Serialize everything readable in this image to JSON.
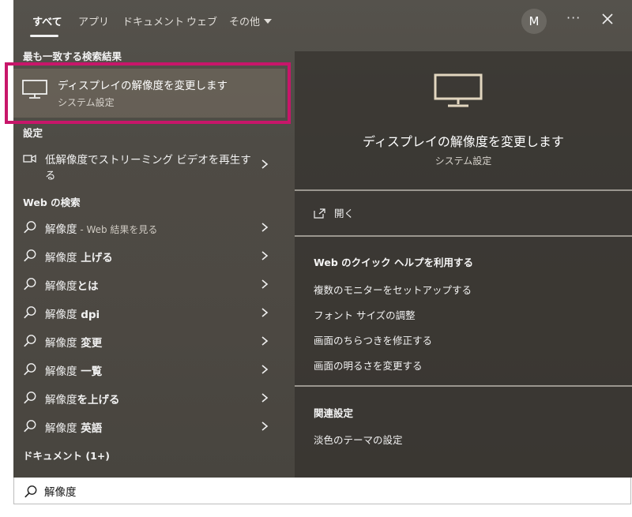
{
  "tabs": [
    {
      "label": "すべて",
      "active": true
    },
    {
      "label": "アプリ"
    },
    {
      "label": "ドキュメント"
    },
    {
      "label": "ウェブ"
    },
    {
      "label": "その他"
    }
  ],
  "account": {
    "initial": "M"
  },
  "more_label": "···",
  "best_match": {
    "heading": "最も一致する検索結果",
    "title": "ディスプレイの解像度を変更します",
    "subtitle": "システム設定",
    "icon": "monitor-icon"
  },
  "settings": {
    "heading": "設定",
    "items": [
      {
        "label_line1": "低解像度でストリーミング ビデオを再生す",
        "label_line2": "る",
        "icon": "video-icon"
      }
    ]
  },
  "web_search": {
    "heading": "Web の検索",
    "items": [
      {
        "query": "解像度",
        "suffix": " - Web 結果を見る"
      },
      {
        "query": "解像度",
        "bold": " 上げる"
      },
      {
        "query": "解像度",
        "bold": "とは"
      },
      {
        "query": "解像度",
        "bold": " dpi"
      },
      {
        "query": "解像度",
        "bold": " 変更"
      },
      {
        "query": "解像度",
        "bold": " 一覧"
      },
      {
        "query": "解像度",
        "bold": "を上げる"
      },
      {
        "query": "解像度",
        "bold": " 英語"
      }
    ]
  },
  "documents": {
    "heading": "ドキュメント (1+)"
  },
  "preview": {
    "title": "ディスプレイの解像度を変更します",
    "subtitle": "システム設定",
    "open_label": "開く",
    "web_help_heading": "Web のクイック ヘルプを利用する",
    "web_help_links": [
      "複数のモニターをセットアップする",
      "フォント サイズの調整",
      "画面のちらつきを修正する",
      "画面の明るさを変更する"
    ],
    "related_heading": "関連設定",
    "related_links": [
      "淡色のテーマの設定"
    ]
  },
  "search": {
    "value": "解像度",
    "icon": "search-icon"
  },
  "colors": {
    "highlight": "#c8166a",
    "accent": "#f0f0f0"
  }
}
